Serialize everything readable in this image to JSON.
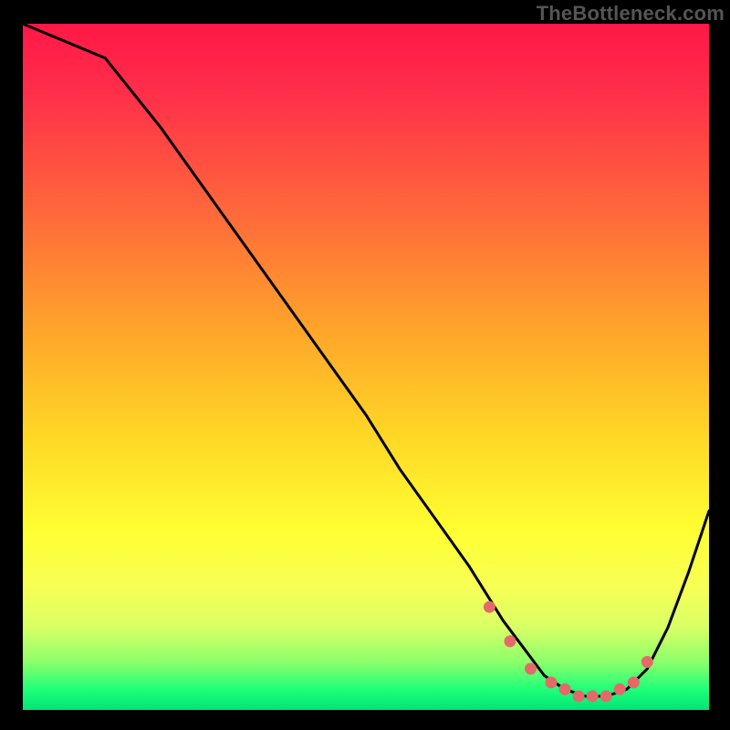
{
  "watermark": {
    "text": "TheBottleneck.com"
  },
  "chart_data": {
    "type": "line",
    "title": "",
    "xlabel": "",
    "ylabel": "",
    "xlim": [
      0,
      100
    ],
    "ylim": [
      0,
      100
    ],
    "series": [
      {
        "name": "bottleneck-curve",
        "x": [
          0,
          12,
          20,
          30,
          40,
          50,
          55,
          60,
          65,
          70,
          73,
          76,
          79,
          82,
          85,
          88,
          91,
          94,
          97,
          100
        ],
        "y": [
          100,
          95,
          85,
          71,
          57,
          43,
          35,
          28,
          21,
          13,
          9,
          5,
          3,
          2,
          2,
          3,
          6,
          12,
          20,
          29
        ]
      }
    ],
    "markers": {
      "name": "bottleneck-suggestion-dots",
      "x": [
        68,
        71,
        74,
        77,
        79,
        81,
        83,
        85,
        87,
        89,
        91
      ],
      "y": [
        15,
        10,
        6,
        4,
        3,
        2,
        2,
        2,
        3,
        4,
        7
      ]
    },
    "background": {
      "type": "vertical-gradient",
      "stops": [
        {
          "pos": 0.0,
          "color": "#ff1846"
        },
        {
          "pos": 0.28,
          "color": "#ff6a3a"
        },
        {
          "pos": 0.6,
          "color": "#ffd726"
        },
        {
          "pos": 0.82,
          "color": "#f7ff55"
        },
        {
          "pos": 1.0,
          "color": "#00e676"
        }
      ]
    }
  }
}
